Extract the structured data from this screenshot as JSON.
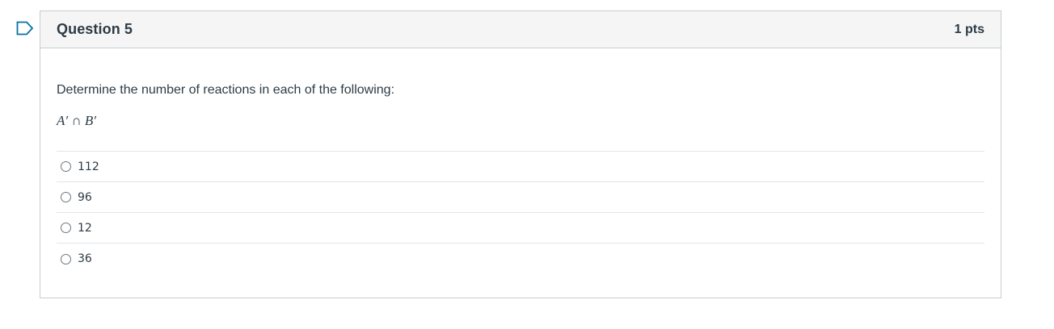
{
  "question": {
    "title": "Question 5",
    "points": "1 pts",
    "text": "Determine the number of reactions in each of the following:",
    "expression": "A′ ∩ B′"
  },
  "answers": [
    {
      "label": "112"
    },
    {
      "label": "96"
    },
    {
      "label": "12"
    },
    {
      "label": "36"
    }
  ],
  "colors": {
    "header_bg": "#f5f5f5",
    "border": "#c7cdd1",
    "text": "#2d3b45",
    "flag": "#0770a3"
  },
  "icons": {
    "flag": "flag-question-icon",
    "radio": "radio-unchecked-icon"
  }
}
